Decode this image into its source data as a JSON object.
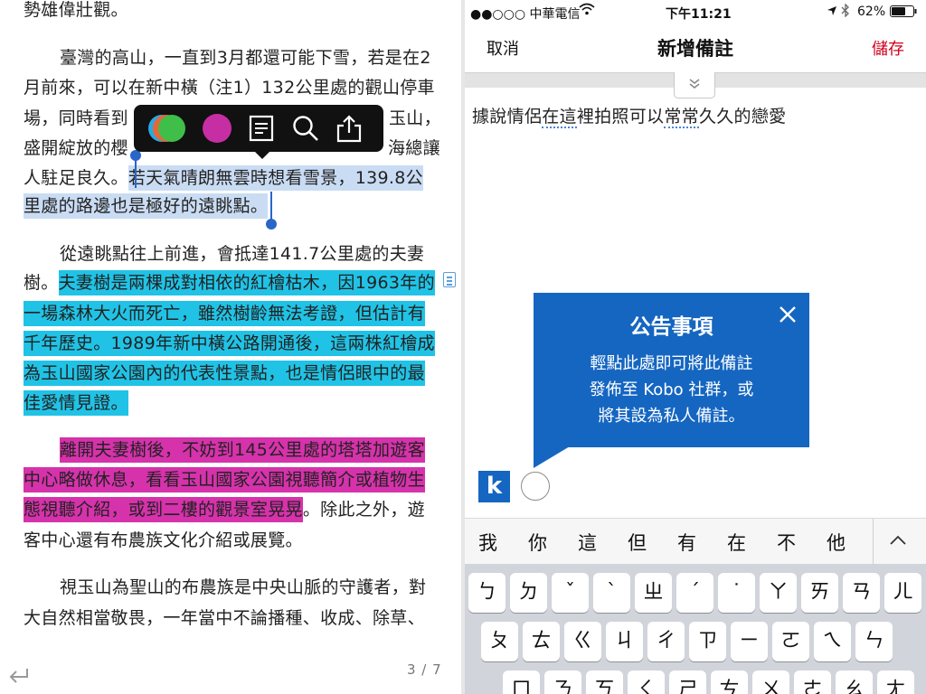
{
  "reader": {
    "lines": [
      "勢雄偉壯觀。",
      "臺灣的高山，一直到3月都還可能下雪，若是在2",
      "月前來，可以在新中橫（注1）132公里處的觀山停車",
      "場，同時看到",
      "玉山，",
      "盛開綻放的櫻",
      "海總讓",
      "人駐足良久。",
      "若天氣晴朗無雲時想看雪景，139.8公",
      "里處的路邊也是極好的遠眺點。",
      "從遠眺點往上前進，會抵達141.7公里處的夫妻",
      "樹。",
      "夫妻樹是兩棵成對相依的紅檜枯木，因1963年的",
      "一場森林大火而死亡，雖然樹齡無法考證，但估計有",
      "千年歷史。1989年新中橫公路開通後，這兩株紅檜成",
      "為玉山國家公園內的代表性景點，也是情侶眼中的最",
      "佳愛情見證。",
      "離開夫妻樹後，不妨到145公里處的塔塔加遊客",
      "中心略做休息，看看玉山國家公園視聽簡介或植物生",
      "態視聽介紹，或到二樓的觀景室晃晃",
      "。除此之外，遊",
      "客中心還有布農族文化介紹或展覽。",
      "視玉山為聖山的布農族是中央山脈的守護者，對",
      "大自然相當敬畏，一年當中不論播種、收成、除草、"
    ],
    "page_indicator": "3 / 7",
    "highlight_colors": {
      "selection": "#c9dcf3",
      "cyan": "#20c3e6",
      "magenta": "#d632ab"
    },
    "popup_icons": [
      "multicolor-highlight-icon",
      "magenta-highlight-icon",
      "note-icon",
      "search-icon",
      "share-icon"
    ]
  },
  "status_bar": {
    "carrier": "●●○○○ 中華電信",
    "time": "下午11:21",
    "battery": "62%"
  },
  "note_editor": {
    "cancel_label": "取消",
    "title": "新增備註",
    "save_label": "儲存",
    "note_text_parts": [
      "據說情侶",
      "在這",
      "裡拍照可以",
      "常常",
      "久久的戀愛"
    ]
  },
  "callout": {
    "title": "公告事項",
    "body": [
      "輕點此處即可將此備註",
      "發佈至 Kobo 社群，或",
      "將其設為私人備註。"
    ]
  },
  "kobo_logo_letter": "k",
  "suggestions": [
    "我",
    "你",
    "這",
    "但",
    "有",
    "在",
    "不",
    "他"
  ],
  "keyboard": {
    "row1": [
      "ㄅ",
      "ㄉ",
      "ˇ",
      "ˋ",
      "ㄓ",
      "ˊ",
      "˙",
      "ㄚ",
      "ㄞ",
      "ㄢ",
      "ㄦ"
    ],
    "row2": [
      "ㄆ",
      "ㄊ",
      "ㄍ",
      "ㄐ",
      "ㄔ",
      "ㄗ",
      "ㄧ",
      "ㄛ",
      "ㄟ",
      "ㄣ"
    ],
    "row3": [
      "ㄇ",
      "ㄋ",
      "ㄎ",
      "ㄑ",
      "ㄕ",
      "ㄘ",
      "ㄨ",
      "ㄜ",
      "ㄠ",
      "ㄤ"
    ]
  }
}
